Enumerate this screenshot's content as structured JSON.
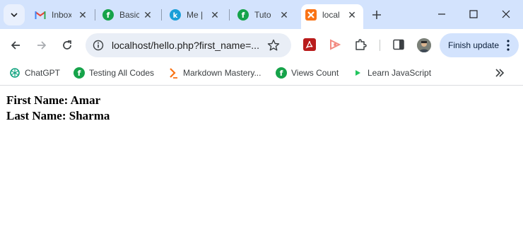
{
  "tabs": [
    {
      "title": "Inbox",
      "icon": "gmail-icon"
    },
    {
      "title": "Basic",
      "icon": "green-f-icon"
    },
    {
      "title": "Me |",
      "icon": "k-icon"
    },
    {
      "title": "Tuto",
      "icon": "green-f-icon"
    },
    {
      "title": "local",
      "icon": "xampp-icon",
      "active": true
    }
  ],
  "toolbar": {
    "url": "localhost/hello.php?first_name=...",
    "finish_update_label": "Finish update"
  },
  "bookmarks": [
    {
      "label": "ChatGPT",
      "icon": "chatgpt-icon"
    },
    {
      "label": "Testing All Codes",
      "icon": "green-f-icon"
    },
    {
      "label": "Markdown Mastery...",
      "icon": "markdown-icon"
    },
    {
      "label": "Views Count",
      "icon": "green-f-icon"
    },
    {
      "label": "Learn JavaScript",
      "icon": "play-icon"
    }
  ],
  "page": {
    "line1": "First Name: Amar",
    "line2": "Last Name: Sharma"
  },
  "colors": {
    "tabstrip_bg": "#d3e3fd",
    "omnibox_bg": "#e9eef6",
    "brand_green": "#16a34a",
    "xampp_orange": "#f97316"
  }
}
